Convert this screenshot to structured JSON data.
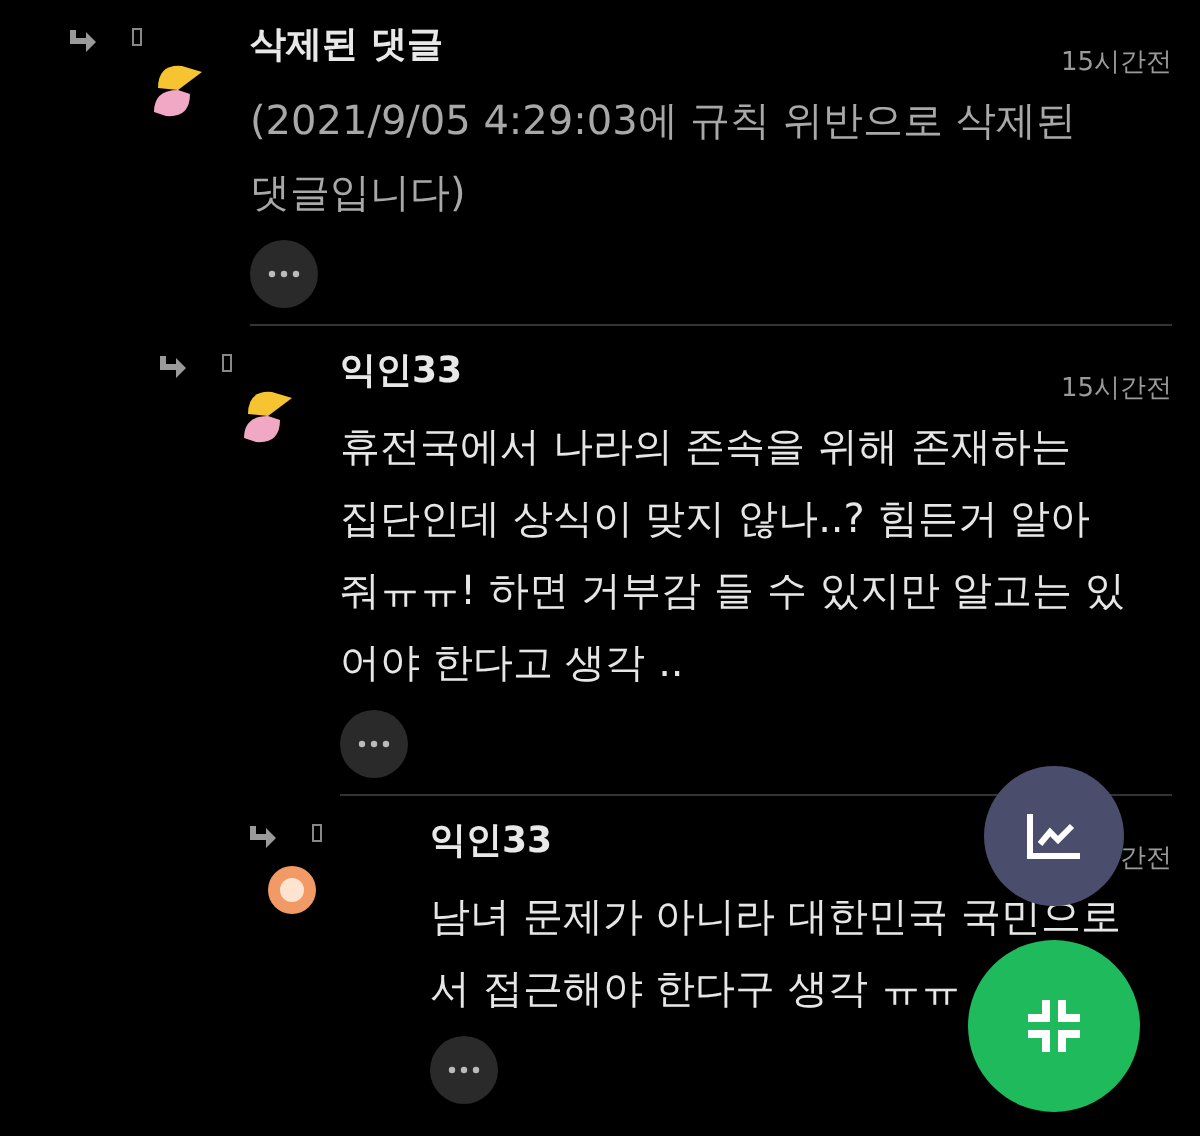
{
  "comments": [
    {
      "author": "삭제된 댓글",
      "time": "15시간전",
      "kind": "split",
      "text": "(2021/9/05 4:29:03에 규칙 위반으로 삭제된\n댓글입니다)",
      "deleted": true,
      "children": [
        {
          "author": "익인33",
          "time": "15시간전",
          "kind": "split",
          "text": "휴전국에서 나라의 존속을 위해 존재하는\n집단인데 상식이 맞지 않나..? 힘든거 알아\n줘ㅠㅠ! 하면 거부감 들 수 있지만 알고는 있\n어야 한다고 생각 ..",
          "deleted": false,
          "children": [
            {
              "author": "익인33",
              "time": "간전",
              "kind": "dot",
              "text": "남녀 문제가 아니라 대한민국 국민으로\n서 접근해야 한다구 생각 ㅠㅠ",
              "deleted": false
            }
          ]
        }
      ]
    }
  ]
}
